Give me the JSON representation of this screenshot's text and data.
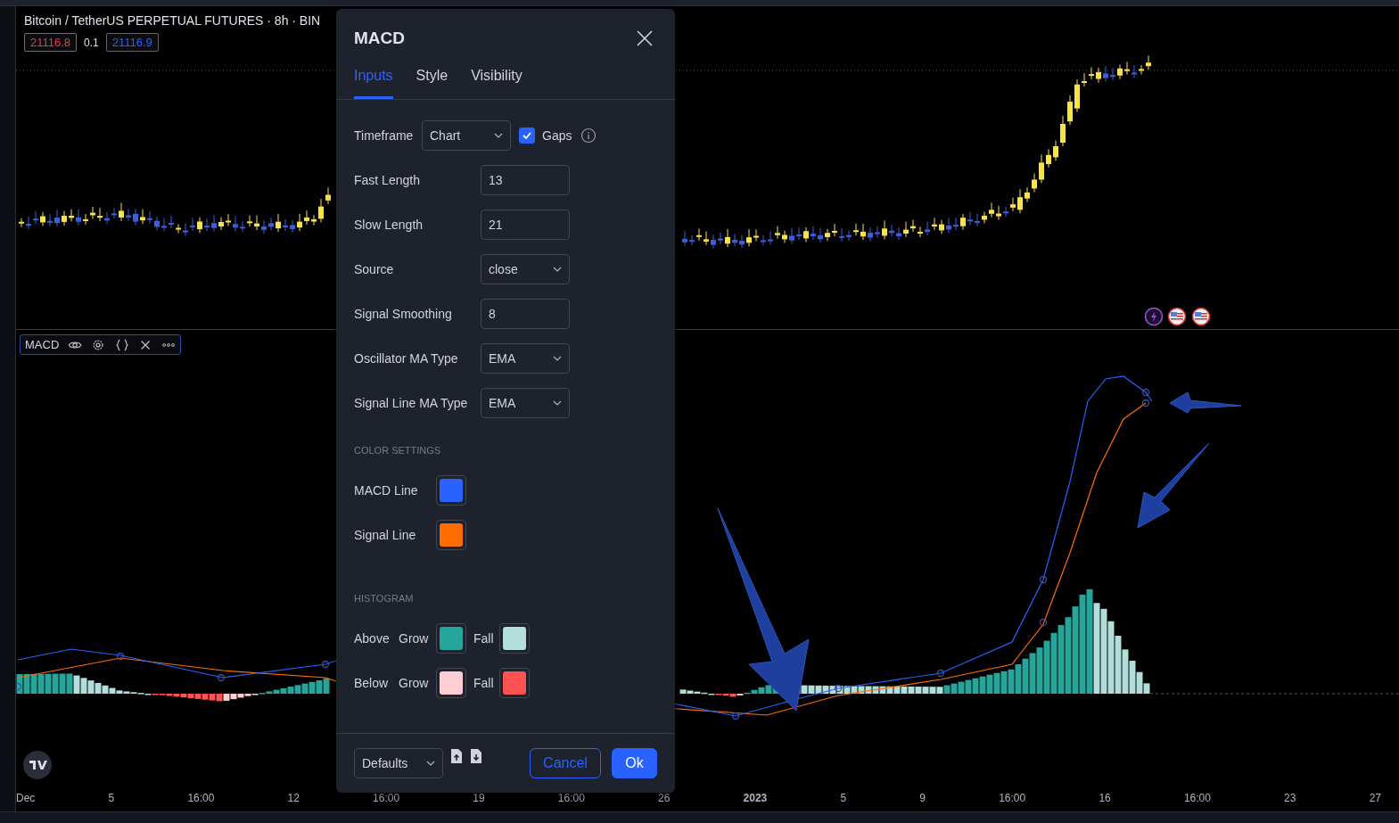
{
  "chart_header": {
    "title": "Bitcoin / TetherUS PERPETUAL FUTURES · 8h · BIN",
    "bid": "21116.8",
    "spread": "0.1",
    "ask": "21116.9"
  },
  "indicator_toolbar": {
    "label": "MACD"
  },
  "time_axis": [
    {
      "label": "Dec",
      "kind": "tick"
    },
    {
      "label": "5",
      "kind": "tick"
    },
    {
      "label": "16:00",
      "kind": "tick"
    },
    {
      "label": "12",
      "kind": "tick"
    },
    {
      "label": "16:00",
      "kind": "tick"
    },
    {
      "label": "19",
      "kind": "tick"
    },
    {
      "label": "16:00",
      "kind": "tick"
    },
    {
      "label": "26",
      "kind": "tick"
    },
    {
      "label": "2023",
      "kind": "year"
    },
    {
      "label": "5",
      "kind": "tick"
    },
    {
      "label": "9",
      "kind": "tick"
    },
    {
      "label": "16:00",
      "kind": "tick"
    },
    {
      "label": "16",
      "kind": "tick"
    },
    {
      "label": "16:00",
      "kind": "tick"
    },
    {
      "label": "23",
      "kind": "tick"
    },
    {
      "label": "27",
      "kind": "tick"
    }
  ],
  "dialog": {
    "title": "MACD",
    "tabs": [
      {
        "label": "Inputs",
        "selected": true
      },
      {
        "label": "Style",
        "selected": false
      },
      {
        "label": "Visibility",
        "selected": false
      }
    ],
    "timeframe": {
      "label": "Timeframe",
      "value": "Chart",
      "gaps": {
        "label": "Gaps",
        "checked": true
      }
    },
    "inputs": [
      {
        "label": "Fast Length",
        "kind": "number",
        "value": "13"
      },
      {
        "label": "Slow Length",
        "kind": "number",
        "value": "21"
      },
      {
        "label": "Source",
        "kind": "select",
        "value": "close"
      },
      {
        "label": "Signal Smoothing",
        "kind": "number",
        "value": "8"
      },
      {
        "label": "Oscillator MA Type",
        "kind": "select",
        "value": "EMA"
      },
      {
        "label": "Signal Line MA Type",
        "kind": "select",
        "value": "EMA"
      }
    ],
    "color_sections": [
      {
        "heading": "COLOR SETTINGS",
        "rows": [
          {
            "label": "MACD Line",
            "swatches": [
              {
                "color": "#2962ff"
              }
            ]
          },
          {
            "label": "Signal Line",
            "swatches": [
              {
                "color": "#ff6d00"
              }
            ]
          }
        ]
      },
      {
        "heading": "HISTOGRAM",
        "rows": [
          {
            "label": "Above",
            "swatches": [
              {
                "label": "Grow",
                "color": "#26a69a"
              },
              {
                "label": "Fall",
                "color": "#b2dfdb"
              }
            ]
          },
          {
            "label": "Below",
            "swatches": [
              {
                "label": "Grow",
                "color": "#ffcdd2"
              },
              {
                "label": "Fall",
                "color": "#ff5252"
              }
            ]
          }
        ]
      }
    ],
    "footer": {
      "preset": "Defaults",
      "cancel": "Cancel",
      "ok": "Ok"
    }
  }
}
